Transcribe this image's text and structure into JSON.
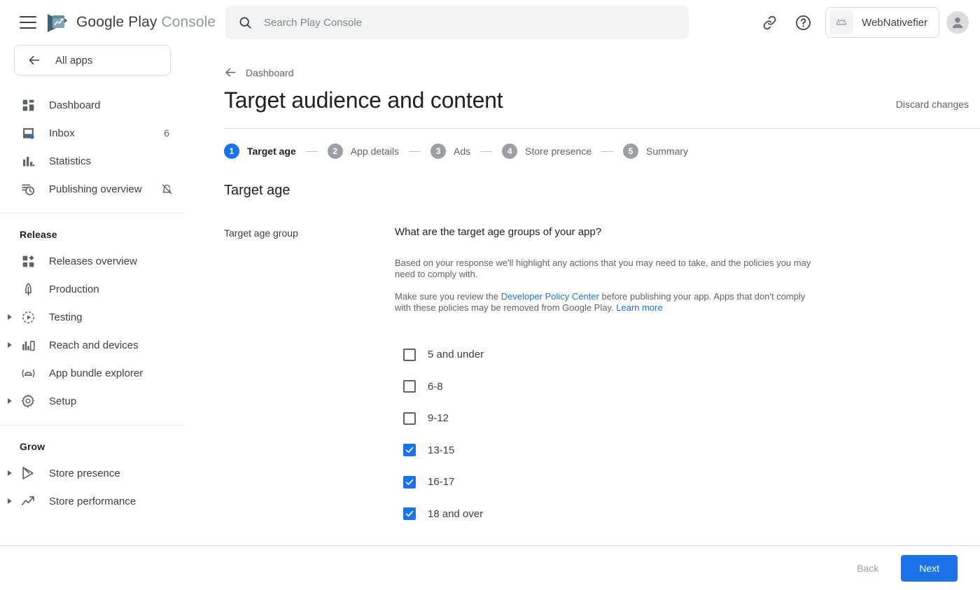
{
  "brand": {
    "name_primary": "Google Play",
    "name_secondary": "Console",
    "logo_icon": "play-console-logo-icon",
    "menu_icon": "hamburger-menu-icon"
  },
  "search": {
    "placeholder": "Search Play Console",
    "value": "",
    "icon": "search-icon"
  },
  "header": {
    "link_icon": "link-icon",
    "help_icon": "help-circle-icon",
    "account_name": "WebNativefier",
    "account_icon": "android-app-icon",
    "avatar_icon": "user-avatar-icon"
  },
  "sidebar": {
    "all_apps": {
      "label": "All apps",
      "icon": "arrow-left-icon"
    },
    "items": [
      {
        "label": "Dashboard",
        "icon": "dashboard-grid-icon",
        "badge": "",
        "expandable": false,
        "trailing_icon": ""
      },
      {
        "label": "Inbox",
        "icon": "inbox-icon",
        "badge": "6",
        "expandable": false,
        "trailing_icon": ""
      },
      {
        "label": "Statistics",
        "icon": "bar-chart-icon",
        "badge": "",
        "expandable": false,
        "trailing_icon": ""
      },
      {
        "label": "Publishing overview",
        "icon": "publishing-clock-icon",
        "badge": "",
        "expandable": false,
        "trailing_icon": "notifications-off-icon"
      }
    ],
    "sections": [
      {
        "title": "Release",
        "items": [
          {
            "label": "Releases overview",
            "icon": "releases-overview-icon",
            "expandable": false
          },
          {
            "label": "Production",
            "icon": "rocket-icon",
            "expandable": false
          },
          {
            "label": "Testing",
            "icon": "testing-play-icon",
            "expandable": true
          },
          {
            "label": "Reach and devices",
            "icon": "reach-devices-icon",
            "expandable": true
          },
          {
            "label": "App bundle explorer",
            "icon": "app-bundle-icon",
            "expandable": false
          },
          {
            "label": "Setup",
            "icon": "gear-icon",
            "expandable": true
          }
        ]
      },
      {
        "title": "Grow",
        "items": [
          {
            "label": "Store presence",
            "icon": "store-presence-play-icon",
            "expandable": true
          },
          {
            "label": "Store performance",
            "icon": "trending-up-icon",
            "expandable": true
          }
        ]
      }
    ]
  },
  "main": {
    "breadcrumb": {
      "label": "Dashboard",
      "icon": "arrow-left-icon"
    },
    "page_title": "Target audience and content",
    "discard_label": "Discard changes",
    "stepper": [
      {
        "number": "1",
        "label": "Target age",
        "active": true
      },
      {
        "number": "2",
        "label": "App details",
        "active": false
      },
      {
        "number": "3",
        "label": "Ads",
        "active": false
      },
      {
        "number": "4",
        "label": "Store presence",
        "active": false
      },
      {
        "number": "5",
        "label": "Summary",
        "active": false
      }
    ],
    "section_title": "Target age",
    "form": {
      "label": "Target age group",
      "question": "What are the target age groups of your app?",
      "help_1": "Based on your response we'll highlight any actions that you may need to take, and the policies you may need to comply with.",
      "help_2_prefix": "Make sure you review the ",
      "help_2_link_1": "Developer Policy Center",
      "help_2_middle": " before publishing your app. Apps that don't comply with these policies may be removed from Google Play. ",
      "help_2_link_2": "Learn more"
    },
    "age_groups": [
      {
        "label": "5 and under",
        "checked": false
      },
      {
        "label": "6-8",
        "checked": false
      },
      {
        "label": "9-12",
        "checked": false
      },
      {
        "label": "13-15",
        "checked": true
      },
      {
        "label": "16-17",
        "checked": true
      },
      {
        "label": "18 and over",
        "checked": true
      }
    ]
  },
  "footer": {
    "back_label": "Back",
    "next_label": "Next"
  },
  "colors": {
    "accent_blue": "#1a73e8",
    "inactive_step": "#9aa0a6",
    "text_primary": "#202124",
    "text_secondary": "#5f6368",
    "divider": "#dadce0"
  }
}
